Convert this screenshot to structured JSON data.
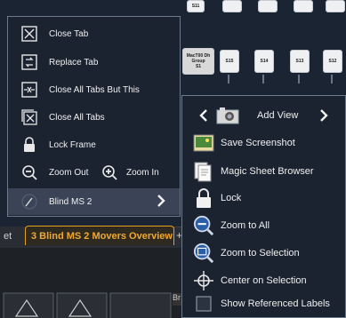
{
  "background": {
    "fixtures": [
      {
        "label": "S15"
      },
      {
        "label": "S14"
      },
      {
        "label": "S13"
      },
      {
        "label": "S12"
      }
    ],
    "group_fixture": {
      "line1": "MacT00 Dh",
      "line2": "Group",
      "line3": "S1"
    },
    "top_fixture": {
      "label": "S11"
    }
  },
  "tabs": {
    "previous_tab": "et",
    "active_tab": "3 Blind MS 2 Movers Overview",
    "add_tab": "+"
  },
  "left_menu": {
    "items": [
      {
        "label": "Close Tab",
        "icon": "close-box-icon"
      },
      {
        "label": "Replace Tab",
        "icon": "replace-tab-icon"
      },
      {
        "label": "Close All Tabs But This",
        "icon": "close-others-icon"
      },
      {
        "label": "Close All Tabs",
        "icon": "close-all-icon"
      },
      {
        "label": "Lock Frame",
        "icon": "lock-icon"
      }
    ],
    "zoom_out": "Zoom Out",
    "zoom_in": "Zoom In",
    "submenu": {
      "label": "Blind MS 2",
      "icon": "pen-icon"
    }
  },
  "right_menu": {
    "header_label": "Add View",
    "items": [
      {
        "label": "Save Screenshot",
        "icon": "screenshot-icon"
      },
      {
        "label": "Magic Sheet Browser",
        "icon": "magic-sheet-icon"
      },
      {
        "label": "Lock",
        "icon": "lock-icon"
      },
      {
        "label": "Zoom to All",
        "icon": "zoom-all-icon"
      },
      {
        "label": "Zoom to Selection",
        "icon": "zoom-selection-icon"
      },
      {
        "label": "Center on Selection",
        "icon": "crosshair-icon"
      },
      {
        "label": "Show Referenced Labels",
        "icon": "checkbox-icon"
      }
    ]
  },
  "bottom": {
    "br_label": "Br"
  },
  "colors": {
    "accent": "#e3a21a",
    "menu_bg": "#1b2230",
    "menu_border": "#6c7a8c"
  }
}
